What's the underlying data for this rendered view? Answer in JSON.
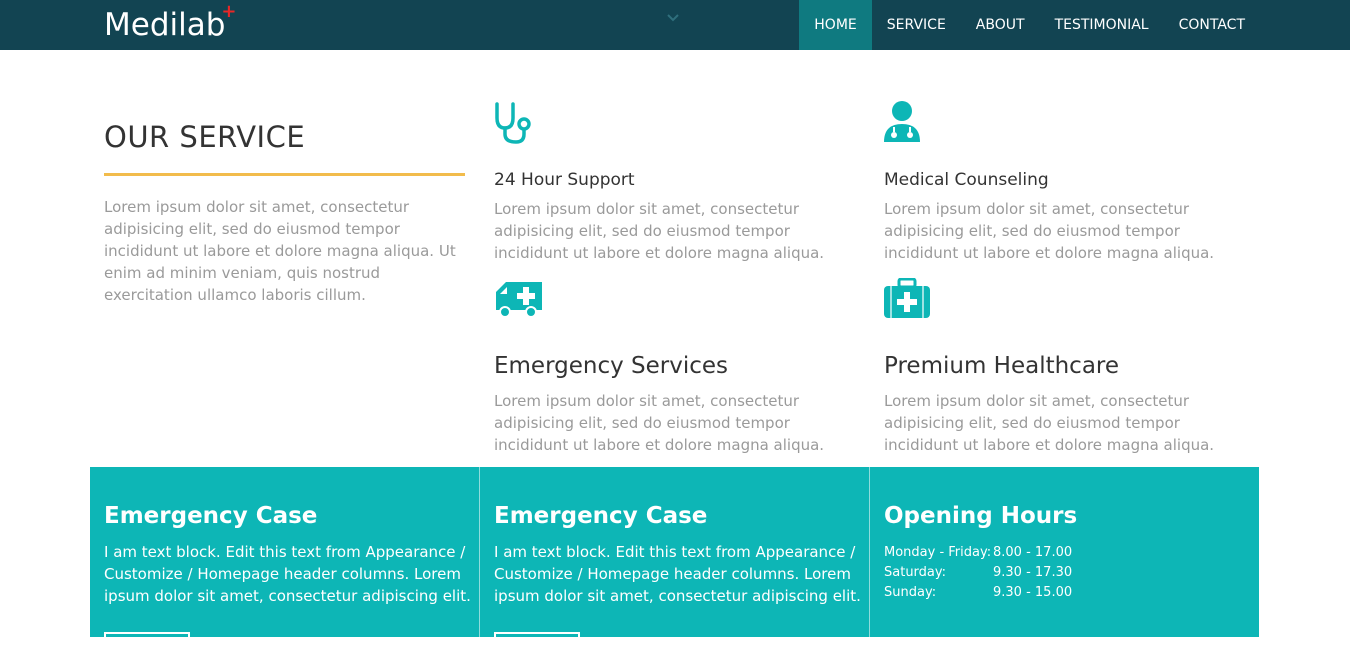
{
  "brand": {
    "name": "Medilab",
    "mark": "+"
  },
  "nav": {
    "items": [
      {
        "label": "HOME",
        "active": true
      },
      {
        "label": "SERVICE",
        "active": false
      },
      {
        "label": "ABOUT",
        "active": false
      },
      {
        "label": "TESTIMONIAL",
        "active": false
      },
      {
        "label": "CONTACT",
        "active": false
      }
    ]
  },
  "service": {
    "title": "OUR SERVICE",
    "intro": "Lorem ipsum dolor sit amet, consectetur adipisicing elit, sed do eiusmod tempor incididunt ut labore et dolore magna aliqua. Ut enim ad minim veniam, quis nostrud exercitation ullamco laboris cillum.",
    "items": [
      {
        "icon": "stethoscope-icon",
        "title": "24 Hour Support",
        "text": "Lorem ipsum dolor sit amet, consectetur adipisicing elit, sed do eiusmod tempor incididunt ut labore et dolore magna aliqua."
      },
      {
        "icon": "doctor-icon",
        "title": "Medical Counseling",
        "text": "Lorem ipsum dolor sit amet, consectetur adipisicing elit, sed do eiusmod tempor incididunt ut labore et dolore magna aliqua."
      },
      {
        "icon": "ambulance-icon",
        "title": "Emergency Services",
        "text": "Lorem ipsum dolor sit amet, consectetur adipisicing elit, sed do eiusmod tempor incididunt ut labore et dolore magna aliqua."
      },
      {
        "icon": "medkit-icon",
        "title": "Premium Healthcare",
        "text": "Lorem ipsum dolor sit amet, consectetur adipisicing elit, sed do eiusmod tempor incididunt ut labore et dolore magna aliqua."
      }
    ]
  },
  "boxes": [
    {
      "title": "Emergency Case",
      "text": "I am text block. Edit this text from Appearance / Customize / Homepage header columns. Lorem ipsum dolor sit amet, consectetur adipiscing elit."
    },
    {
      "title": "Emergency Case",
      "text": "I am text block. Edit this text from Appearance / Customize / Homepage header columns. Lorem ipsum dolor sit amet, consectetur adipiscing elit."
    },
    {
      "title": "Opening Hours",
      "hours": [
        {
          "day": "Monday - Friday:",
          "time": "8.00 - 17.00"
        },
        {
          "day": "Saturday:",
          "time": "9.30 - 17.30"
        },
        {
          "day": "Sunday:",
          "time": "9.30 - 15.00"
        }
      ]
    }
  ],
  "colors": {
    "navbar": "#124452",
    "nav_active": "#0f7a80",
    "accent": "#0db6b6",
    "rule": "#f2bc4c",
    "brand_mark": "#e82727"
  }
}
